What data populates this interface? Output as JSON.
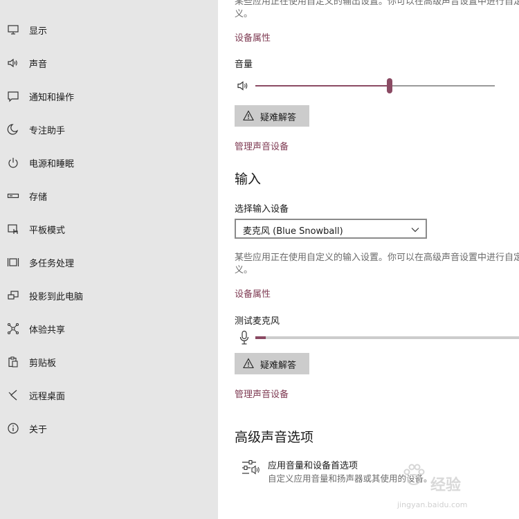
{
  "sidebar": {
    "items": [
      {
        "label": "显示",
        "icon": "monitor-icon"
      },
      {
        "label": "声音",
        "icon": "speaker-icon"
      },
      {
        "label": "通知和操作",
        "icon": "notification-icon"
      },
      {
        "label": "专注助手",
        "icon": "moon-icon"
      },
      {
        "label": "电源和睡眠",
        "icon": "power-icon"
      },
      {
        "label": "存储",
        "icon": "storage-icon"
      },
      {
        "label": "平板模式",
        "icon": "tablet-mode-icon"
      },
      {
        "label": "多任务处理",
        "icon": "multitasking-icon"
      },
      {
        "label": "投影到此电脑",
        "icon": "projection-icon"
      },
      {
        "label": "体验共享",
        "icon": "shared-experiences-icon"
      },
      {
        "label": "剪贴板",
        "icon": "clipboard-icon"
      },
      {
        "label": "远程桌面",
        "icon": "remote-desktop-icon"
      },
      {
        "label": "关于",
        "icon": "info-icon"
      }
    ]
  },
  "output": {
    "description": "某些应用正在使用自定义的输出设置。你可以在高级声音设置中进行自定义。",
    "device_properties_link": "设备属性",
    "volume_label": "音量",
    "volume_level": 0.56,
    "troubleshoot_label": "疑难解答",
    "manage_devices_link": "管理声音设备"
  },
  "input": {
    "heading": "输入",
    "select_label": "选择输入设备",
    "selected_device": "麦克风 (Blue Snowball)",
    "description": "某些应用正在使用自定义的输入设置。你可以在高级声音设置中进行自定义。",
    "device_properties_link": "设备属性",
    "test_mic_label": "测试麦克风",
    "mic_level": 0.04,
    "troubleshoot_label": "疑难解答",
    "manage_devices_link": "管理声音设备"
  },
  "advanced": {
    "heading": "高级声音选项",
    "app_volume_title": "应用音量和设备首选项",
    "app_volume_desc": "自定义应用音量和扬声器或其使用的设备。"
  },
  "watermark": {
    "text": "经验",
    "sub": "jingyan.baidu.com"
  },
  "colors": {
    "accent": "#8a4a63",
    "link": "#7f3b53",
    "sidebar_bg": "#e6e6e6"
  }
}
